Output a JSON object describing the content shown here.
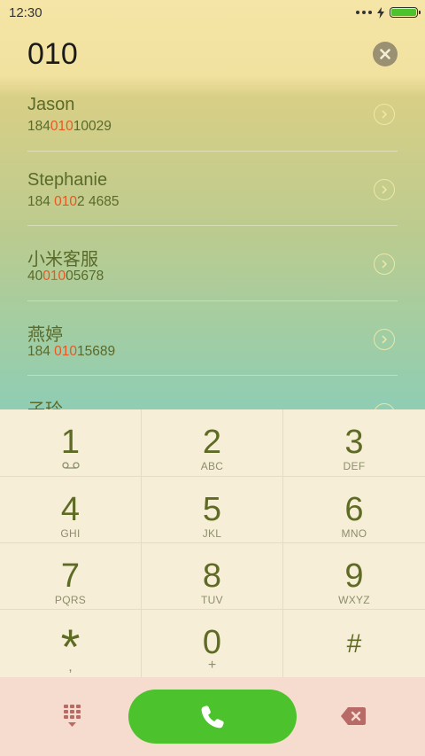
{
  "status_bar": {
    "time": "12:30"
  },
  "dialer": {
    "input_value": "010"
  },
  "results": [
    {
      "name": "Jason",
      "number_pre": "184",
      "number_match": "010",
      "number_post": "10029"
    },
    {
      "name": "Stephanie",
      "number_pre": "184 ",
      "number_match": "010",
      "number_post": "2 4685"
    },
    {
      "name": "小米客服",
      "number_pre": "40",
      "number_match": "010",
      "number_post": "05678"
    },
    {
      "name": "燕婷",
      "number_pre": "184 ",
      "number_match": "010",
      "number_post": "15689"
    },
    {
      "name": "子玲",
      "number_pre": "",
      "number_match": "",
      "number_post": ""
    }
  ],
  "keypad": [
    {
      "digit": "1",
      "letters": ""
    },
    {
      "digit": "2",
      "letters": "ABC"
    },
    {
      "digit": "3",
      "letters": "DEF"
    },
    {
      "digit": "4",
      "letters": "GHI"
    },
    {
      "digit": "5",
      "letters": "JKL"
    },
    {
      "digit": "6",
      "letters": "MNO"
    },
    {
      "digit": "7",
      "letters": "PQRS"
    },
    {
      "digit": "8",
      "letters": "TUV"
    },
    {
      "digit": "9",
      "letters": "WXYZ"
    },
    {
      "digit": "*",
      "letters": ","
    },
    {
      "digit": "0",
      "letters": "+"
    },
    {
      "digit": "#",
      "letters": ""
    }
  ],
  "icons": {
    "voicemail": "voicemail-icon",
    "clear": "close-icon",
    "detail": "chevron-right-icon",
    "dialpad": "dialpad-icon",
    "call": "phone-icon",
    "backspace": "backspace-icon"
  },
  "colors": {
    "accent": "#4cc22c",
    "highlight": "#e8581f",
    "text": "#5a6a2a",
    "backspace": "#b86b66"
  }
}
